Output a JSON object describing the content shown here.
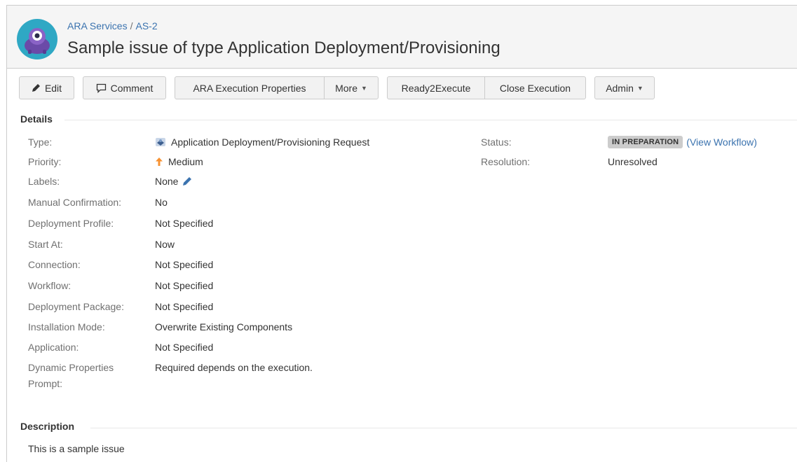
{
  "breadcrumb": {
    "project": "ARA Services",
    "separator": "/",
    "issue_key": "AS-2"
  },
  "issue": {
    "title": "Sample issue of type Application Deployment/Provisioning"
  },
  "toolbar": {
    "edit": "Edit",
    "comment": "Comment",
    "ara_exec_props": "ARA Execution Properties",
    "more": "More",
    "ready2execute": "Ready2Execute",
    "close_execution": "Close Execution",
    "admin": "Admin"
  },
  "details": {
    "heading": "Details",
    "fields": [
      {
        "label": "Type:",
        "value": "Application Deployment/Provisioning Request"
      },
      {
        "label": "Priority:",
        "value": "Medium"
      },
      {
        "label": "Labels:",
        "value": "None"
      },
      {
        "label": "Manual Confirmation:",
        "value": "No"
      },
      {
        "label": "Deployment Profile:",
        "value": "Not Specified"
      },
      {
        "label": "Start At:",
        "value": "Now"
      },
      {
        "label": "Connection:",
        "value": "Not Specified"
      },
      {
        "label": "Workflow:",
        "value": "Not Specified"
      },
      {
        "label": "Deployment Package:",
        "value": "Not Specified"
      },
      {
        "label": "Installation Mode:",
        "value": "Overwrite Existing Components"
      },
      {
        "label": "Application:",
        "value": "Not Specified"
      },
      {
        "label_line1": "Dynamic Properties",
        "label_line2": "Prompt:",
        "value": "Required depends on the execution."
      }
    ],
    "right": {
      "status_label": "Status:",
      "status_value": "IN PREPARATION",
      "view_workflow": "(View Workflow)",
      "resolution_label": "Resolution:",
      "resolution_value": "Unresolved"
    }
  },
  "description": {
    "heading": "Description",
    "text": "This is a sample issue"
  },
  "colors": {
    "link": "#3b73af",
    "priority_medium": "#f79232",
    "header_bg": "#f5f5f5",
    "lozenge": "#cccccc"
  },
  "icons": {
    "edit": "pencil-icon",
    "comment": "comment-icon",
    "type": "deployment-type-icon",
    "priority": "arrow-up-icon",
    "labels_edit": "pencil-icon"
  }
}
